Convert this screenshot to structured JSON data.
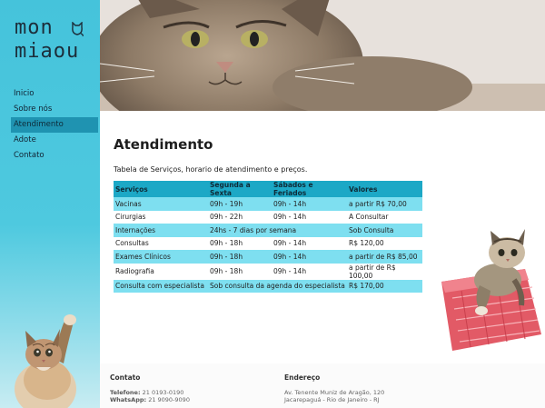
{
  "logo": {
    "line1": "mon",
    "line2": "miaou"
  },
  "nav": [
    {
      "label": "Inicio",
      "active": false
    },
    {
      "label": "Sobre nós",
      "active": false
    },
    {
      "label": "Atendimento",
      "active": true
    },
    {
      "label": "Adote",
      "active": false
    },
    {
      "label": "Contato",
      "active": false
    }
  ],
  "main": {
    "title": "Atendimento",
    "intro": "Tabela de Serviços, horario de atendimento e preços.",
    "table": {
      "headers": [
        "Serviços",
        "Segunda a Sexta",
        "Sábados e Feriados",
        "Valores"
      ],
      "rows": [
        [
          "Vacinas",
          "09h - 19h",
          "09h - 14h",
          "a partir R$ 70,00"
        ],
        [
          "Cirurgias",
          "09h - 22h",
          "09h - 14h",
          "A Consultar"
        ],
        [
          "Internações",
          "24hs - 7 dias por semana",
          "",
          "Sob Consulta"
        ],
        [
          "Consultas",
          "09h - 18h",
          "09h - 14h",
          "R$ 120,00"
        ],
        [
          "Exames Clínicos",
          "09h - 18h",
          "09h - 14h",
          "a partir de R$ 85,00"
        ],
        [
          "Radiografia",
          "09h - 18h",
          "09h - 14h",
          "a partir de R$ 100,00"
        ],
        [
          "Consulta com especialista",
          "Sob consulta da agenda do especialista",
          "",
          "R$ 170,00"
        ]
      ]
    }
  },
  "footer": {
    "contact_title": "Contato",
    "phone_label": "Telefone:",
    "phone": "21 0193-0190",
    "whatsapp_label": "WhatsApp:",
    "whatsapp": "21 9090-9090",
    "address_title": "Endereço",
    "address_line1": "Av. Tenente Muniz de Aragão, 120",
    "address_line2": "Jacarepaguá - Rio de Janeiro - RJ"
  },
  "colors": {
    "sidebar": "#45c3db",
    "nav_active": "#1f93b1",
    "table_header": "#1ca8c6",
    "table_stripe": "#7edff0"
  }
}
